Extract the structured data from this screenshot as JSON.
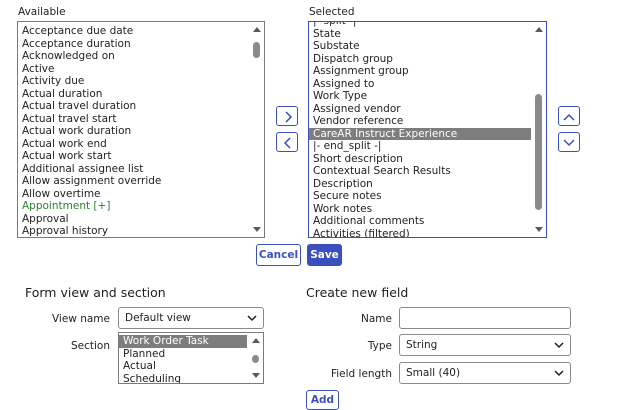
{
  "available": {
    "label": "Available",
    "items": [
      {
        "text": "Acceptance due date"
      },
      {
        "text": "Acceptance duration"
      },
      {
        "text": "Acknowledged on"
      },
      {
        "text": "Active"
      },
      {
        "text": "Activity due"
      },
      {
        "text": "Actual duration"
      },
      {
        "text": "Actual travel duration"
      },
      {
        "text": "Actual travel start"
      },
      {
        "text": "Actual work duration"
      },
      {
        "text": "Actual work end"
      },
      {
        "text": "Actual work start"
      },
      {
        "text": "Additional assignee list"
      },
      {
        "text": "Allow assignment override"
      },
      {
        "text": "Allow overtime"
      },
      {
        "text": "Appointment [+]",
        "style": "green"
      },
      {
        "text": "Approval"
      },
      {
        "text": "Approval history"
      }
    ]
  },
  "selected": {
    "label": "Selected",
    "items": [
      {
        "text": "|- split -|"
      },
      {
        "text": "State"
      },
      {
        "text": "Substate"
      },
      {
        "text": "Dispatch group"
      },
      {
        "text": "Assignment group"
      },
      {
        "text": "Assigned to"
      },
      {
        "text": "Work Type"
      },
      {
        "text": "Assigned vendor"
      },
      {
        "text": "Vendor reference"
      },
      {
        "text": "CareAR Instruct Experience",
        "style": "sel"
      },
      {
        "text": "|- end_split -|"
      },
      {
        "text": "Short description"
      },
      {
        "text": "Contextual Search Results"
      },
      {
        "text": "Description"
      },
      {
        "text": "Secure notes"
      },
      {
        "text": "Work notes"
      },
      {
        "text": "Additional comments"
      },
      {
        "text": "Activities (filtered)"
      }
    ]
  },
  "actions": {
    "cancel_label": "Cancel",
    "save_label": "Save"
  },
  "form_view": {
    "heading": "Form view and section",
    "view_name_label": "View name",
    "view_name_value": "Default view",
    "section_label": "Section",
    "sections": [
      {
        "text": "Work Order Task",
        "style": "sel"
      },
      {
        "text": "Planned"
      },
      {
        "text": "Actual"
      },
      {
        "text": "Scheduling"
      }
    ]
  },
  "new_field": {
    "heading": "Create new field",
    "name_label": "Name",
    "name_value": "",
    "type_label": "Type",
    "type_value": "String",
    "length_label": "Field length",
    "length_value": "Small (40)",
    "add_label": "Add"
  },
  "colors": {
    "accent": "#3b4fbf",
    "selection": "#7d7d7d",
    "link_green": "#2e7d32"
  }
}
